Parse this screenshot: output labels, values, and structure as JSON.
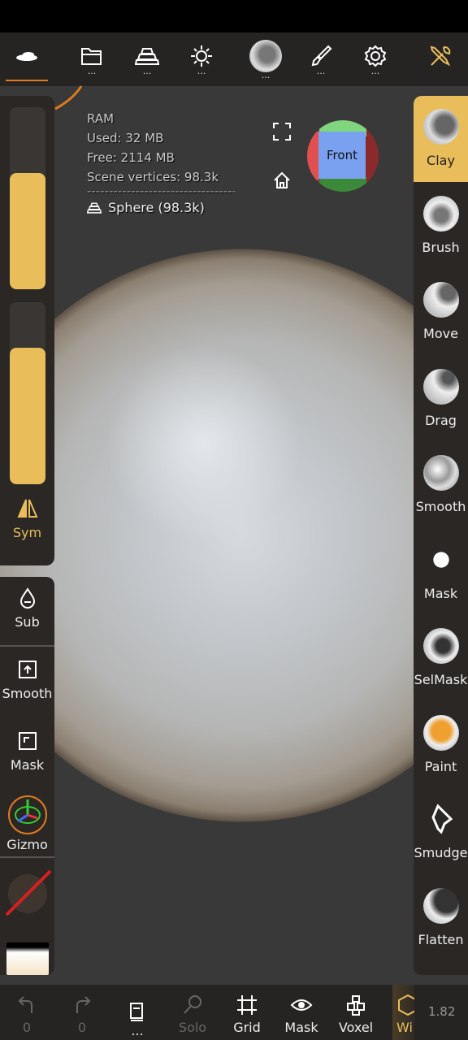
{
  "colors": {
    "accent": "#e9bd5a",
    "underline": "#e07a1f",
    "panel": "#2a2725",
    "viewport": "#393939"
  },
  "topbar": {
    "items": [
      {
        "icon": "scene-icon",
        "dots": ""
      },
      {
        "icon": "folder-icon",
        "dots": "..."
      },
      {
        "icon": "mesh-stack-icon",
        "dots": "..."
      },
      {
        "icon": "sun-icon",
        "dots": "..."
      },
      {
        "icon": "material-sphere-icon",
        "dots": "..."
      },
      {
        "icon": "paint-brush-icon",
        "dots": "..."
      },
      {
        "icon": "gear-icon",
        "dots": "..."
      },
      {
        "icon": "tools-icon",
        "dots": ""
      }
    ]
  },
  "info": {
    "ram": "RAM",
    "used": "Used:  32 MB",
    "free": "Free:  2114 MB",
    "vertices": "Scene vertices:  98.3k",
    "divider": "--------------------------------------------",
    "object": "Sphere (98.3k)"
  },
  "view": {
    "cube_label": "Front"
  },
  "left": {
    "radius_fill": 0.64,
    "intensity_fill": 0.75,
    "sym": "Sym",
    "sub": "Sub",
    "smooth": "Smooth",
    "mask": "Mask",
    "gizmo": "Gizmo"
  },
  "tools": [
    {
      "label": "Clay",
      "active": true
    },
    {
      "label": "Brush"
    },
    {
      "label": "Move"
    },
    {
      "label": "Drag"
    },
    {
      "label": "Smooth"
    },
    {
      "label": "Mask"
    },
    {
      "label": "SelMask"
    },
    {
      "label": "Paint"
    },
    {
      "label": "Smudge"
    },
    {
      "label": "Flatten"
    }
  ],
  "bottom": {
    "undo_count": "0",
    "redo_count": "0",
    "layers_dots": "...",
    "solo": "Solo",
    "grid": "Grid",
    "mask": "Mask",
    "voxel": "Voxel",
    "wire": "Wi",
    "version": "1.82"
  }
}
